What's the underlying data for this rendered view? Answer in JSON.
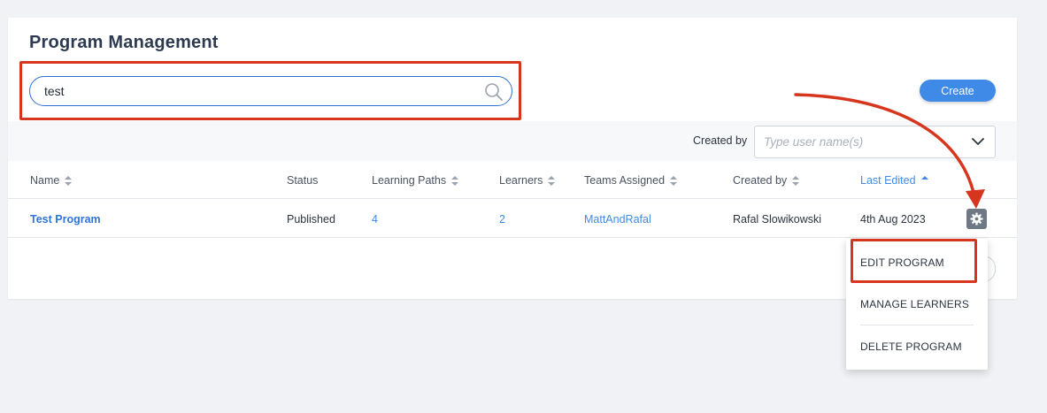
{
  "page": {
    "title": "Program Management"
  },
  "search": {
    "value": "test",
    "icon": "search-icon"
  },
  "toolbar": {
    "create_label": "Create"
  },
  "filter": {
    "label": "Created by",
    "placeholder": "Type user name(s)",
    "icon": "chevron-down-icon"
  },
  "table": {
    "columns": [
      {
        "label": "Name",
        "sortable": true
      },
      {
        "label": "Status",
        "sortable": false
      },
      {
        "label": "Learning Paths",
        "sortable": true
      },
      {
        "label": "Learners",
        "sortable": true
      },
      {
        "label": "Teams Assigned",
        "sortable": true
      },
      {
        "label": "Created by",
        "sortable": true
      },
      {
        "label": "Last Edited",
        "sortable": true,
        "active": true,
        "direction": "asc"
      }
    ],
    "rows": [
      {
        "name": "Test Program",
        "status": "Published",
        "learning_paths": "4",
        "learners": "2",
        "teams_assigned": "MattAndRafal",
        "created_by": "Rafal Slowikowski",
        "last_edited": "4th Aug 2023"
      }
    ]
  },
  "menu": {
    "items": [
      {
        "label": "EDIT PROGRAM"
      },
      {
        "label": "MANAGE LEARNERS"
      },
      {
        "label": "DELETE PROGRAM"
      }
    ]
  },
  "colors": {
    "accent": "#3f8ae6",
    "highlight": "#d6361e",
    "background": "#f0f2f5"
  }
}
